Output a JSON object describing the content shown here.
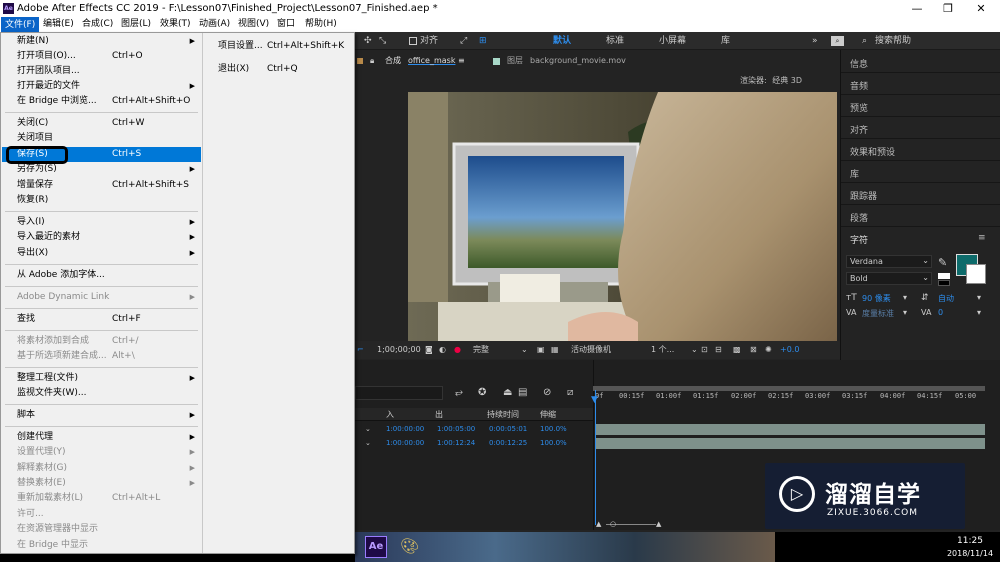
{
  "window": {
    "title": "Adobe After Effects CC 2019 - F:\\Lesson07\\Finished_Project\\Lesson07_Finished.aep *",
    "minimize": "—",
    "restore": "❐",
    "close": "✕"
  },
  "menubar": [
    "文件(F)",
    "编辑(E)",
    "合成(C)",
    "图层(L)",
    "效果(T)",
    "动画(A)",
    "视图(V)",
    "窗口",
    "帮助(H)"
  ],
  "toolbar": {
    "align": "对齐",
    "workspaces": [
      "默认",
      "标准",
      "小屏幕",
      "库"
    ],
    "more": "»",
    "search_placeholder": "搜索帮助"
  },
  "file_menu": [
    {
      "label": "新建(N)",
      "shortcut": "",
      "submenu": true,
      "disabled": false
    },
    {
      "label": "打开项目(O)...",
      "shortcut": "Ctrl+O",
      "submenu": false,
      "disabled": false
    },
    {
      "label": "打开团队项目...",
      "shortcut": "",
      "submenu": false,
      "disabled": false
    },
    {
      "label": "打开最近的文件",
      "shortcut": "",
      "submenu": true,
      "disabled": false
    },
    {
      "label": "在 Bridge 中浏览...",
      "shortcut": "Ctrl+Alt+Shift+O",
      "submenu": false,
      "disabled": false
    },
    {
      "label": "关闭(C)",
      "shortcut": "Ctrl+W",
      "submenu": false,
      "disabled": false
    },
    {
      "label": "关闭项目",
      "shortcut": "",
      "submenu": false,
      "disabled": false
    },
    {
      "label": "保存(S)",
      "shortcut": "Ctrl+S",
      "submenu": false,
      "disabled": false
    },
    {
      "label": "另存为(S)",
      "shortcut": "",
      "submenu": true,
      "disabled": false
    },
    {
      "label": "增量保存",
      "shortcut": "Ctrl+Alt+Shift+S",
      "submenu": false,
      "disabled": false
    },
    {
      "label": "恢复(R)",
      "shortcut": "",
      "submenu": false,
      "disabled": false
    },
    {
      "label": "导入(I)",
      "shortcut": "",
      "submenu": true,
      "disabled": false
    },
    {
      "label": "导入最近的素材",
      "shortcut": "",
      "submenu": true,
      "disabled": false
    },
    {
      "label": "导出(X)",
      "shortcut": "",
      "submenu": true,
      "disabled": false
    },
    {
      "label": "从 Adobe 添加字体...",
      "shortcut": "",
      "submenu": false,
      "disabled": false
    },
    {
      "label": "Adobe Dynamic Link",
      "shortcut": "",
      "submenu": true,
      "disabled": true
    },
    {
      "label": "查找",
      "shortcut": "Ctrl+F",
      "submenu": false,
      "disabled": false
    },
    {
      "label": "将素材添加到合成",
      "shortcut": "Ctrl+/",
      "submenu": false,
      "disabled": true
    },
    {
      "label": "基于所选项新建合成...",
      "shortcut": "Alt+\\",
      "submenu": false,
      "disabled": true
    },
    {
      "label": "整理工程(文件)",
      "shortcut": "",
      "submenu": true,
      "disabled": false
    },
    {
      "label": "监视文件夹(W)...",
      "shortcut": "",
      "submenu": false,
      "disabled": false
    },
    {
      "label": "脚本",
      "shortcut": "",
      "submenu": true,
      "disabled": false
    },
    {
      "label": "创建代理",
      "shortcut": "",
      "submenu": true,
      "disabled": false
    },
    {
      "label": "设置代理(Y)",
      "shortcut": "",
      "submenu": true,
      "disabled": true
    },
    {
      "label": "解释素材(G)",
      "shortcut": "",
      "submenu": true,
      "disabled": true
    },
    {
      "label": "替换素材(E)",
      "shortcut": "",
      "submenu": true,
      "disabled": true
    },
    {
      "label": "重新加载素材(L)",
      "shortcut": "Ctrl+Alt+L",
      "submenu": false,
      "disabled": true
    },
    {
      "label": "许可...",
      "shortcut": "",
      "submenu": false,
      "disabled": true
    },
    {
      "label": "在资源管理器中显示",
      "shortcut": "",
      "submenu": false,
      "disabled": true
    },
    {
      "label": "在 Bridge 中显示",
      "shortcut": "",
      "submenu": false,
      "disabled": true
    }
  ],
  "file_menu_extra": [
    {
      "label": "项目设置...",
      "shortcut": "Ctrl+Alt+Shift+K"
    },
    {
      "label": "退出(X)",
      "shortcut": "Ctrl+Q"
    }
  ],
  "comp_tabs": {
    "comp_prefix": "合成",
    "comp_name": "office_mask",
    "menu": "≡",
    "layer_prefix": "图层",
    "layer_name": "background_movie.mov"
  },
  "renderer": {
    "label": "渲染器:",
    "value": "经典 3D"
  },
  "viewer_bar": {
    "timecode": "1;00;00;00",
    "resolution": "完整",
    "camera": "活动摄像机",
    "views": "1 个...",
    "exposure": "+0.0"
  },
  "right_panel": {
    "items": [
      "信息",
      "音频",
      "预览",
      "对齐",
      "效果和预设",
      "库",
      "跟踪器",
      "段落",
      "字符"
    ],
    "character": {
      "font": "Verdana",
      "style": "Bold",
      "size": "90 像素",
      "leading": "自动",
      "kerning": "度量标准",
      "tracking": "0",
      "fill_color": "#0d6b6b"
    }
  },
  "timeline": {
    "columns": [
      "入",
      "出",
      "持续时间",
      "伸缩"
    ],
    "ruler": [
      "0f",
      "00:15f",
      "01:00f",
      "01:15f",
      "02:00f",
      "02:15f",
      "03:00f",
      "03:15f",
      "04:00f",
      "04:15f",
      "05:00"
    ],
    "rows": [
      {
        "in": "1:00:00:00",
        "out": "1:00:05:00",
        "duration": "0:00:05:01",
        "stretch": "100.0%"
      },
      {
        "in": "1:00:00:00",
        "out": "1:00:12:24",
        "duration": "0:00:12:25",
        "stretch": "100.0%"
      }
    ]
  },
  "watermark": {
    "brand": "溜溜自学",
    "url": "ZIXUE.3066.COM"
  },
  "taskbar": {
    "ae": "Ae",
    "time": "11:25",
    "date": "2018/11/14"
  }
}
